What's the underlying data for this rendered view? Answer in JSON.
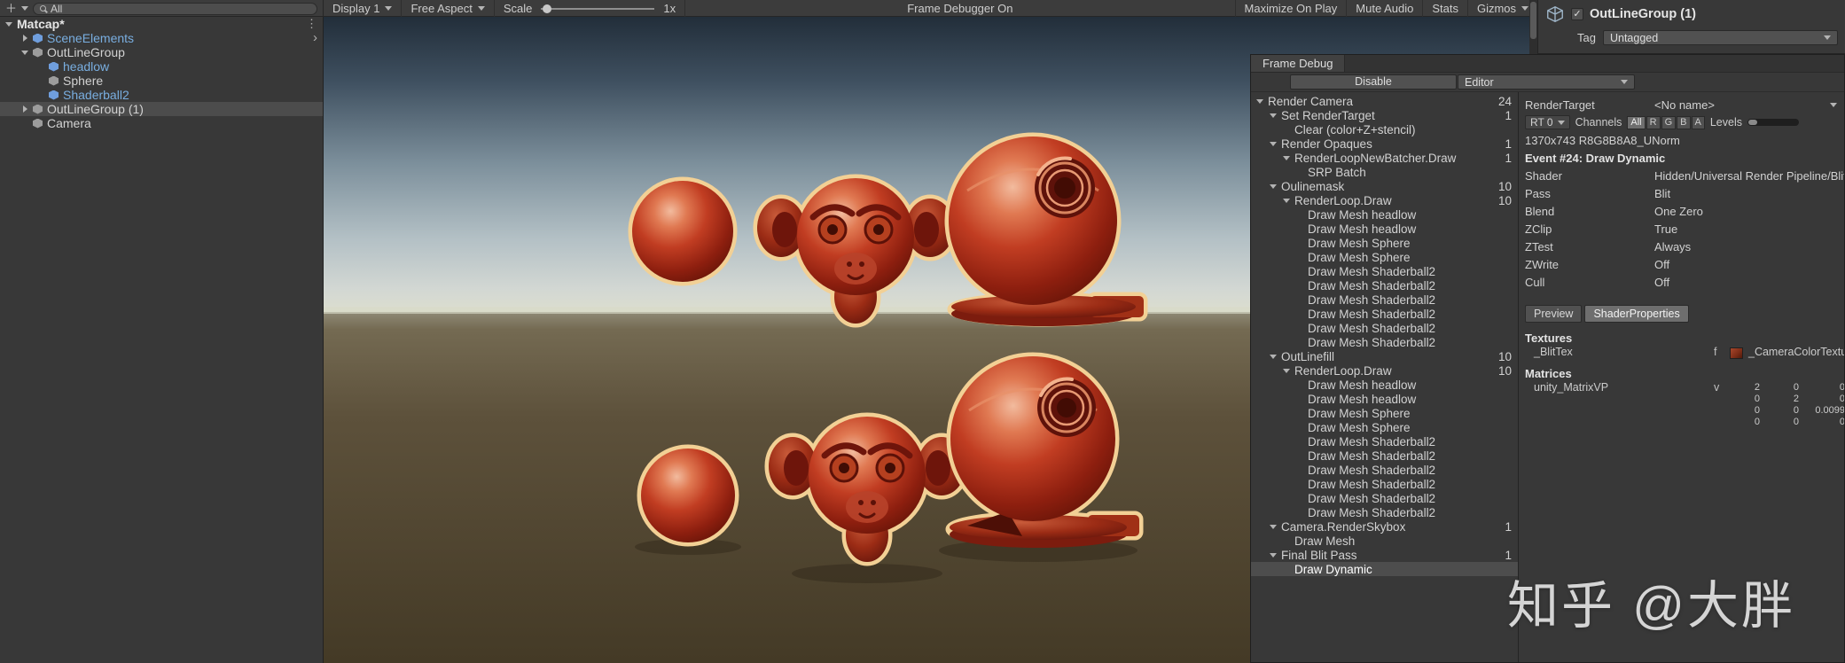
{
  "toolbar": {
    "search_value": "All",
    "display": "Display 1",
    "aspect": "Free Aspect",
    "scale_label": "Scale",
    "scale_value": "1x",
    "frame_debugger_toggle": "Frame Debugger On",
    "maximize_on_play": "Maximize On Play",
    "mute_audio": "Mute Audio",
    "stats": "Stats",
    "gizmos": "Gizmos"
  },
  "hierarchy": {
    "items": [
      {
        "label": "Matcap*",
        "depth": 0,
        "arrow": "down",
        "bold": true,
        "kebab": true
      },
      {
        "label": "SceneElements",
        "depth": 1,
        "arrow": "right",
        "icon": "prefab-cube",
        "prefab": true,
        "chevron": true
      },
      {
        "label": "OutLineGroup",
        "depth": 1,
        "arrow": "down",
        "icon": "cube"
      },
      {
        "label": "headlow",
        "depth": 2,
        "icon": "prefab-cube",
        "prefab": true
      },
      {
        "label": "Sphere",
        "depth": 2,
        "icon": "cube"
      },
      {
        "label": "Shaderball2",
        "depth": 2,
        "icon": "prefab-cube",
        "prefab": true
      },
      {
        "label": "OutLineGroup (1)",
        "depth": 1,
        "arrow": "right",
        "icon": "cube",
        "selected": true
      },
      {
        "label": "Camera",
        "depth": 1,
        "icon": "camera"
      }
    ]
  },
  "frame_debug": {
    "tab_title": "Frame Debug",
    "disable_button": "Disable",
    "editor_dropdown": "Editor",
    "tree": [
      {
        "label": "Render Camera",
        "count": "24",
        "depth": 0,
        "arrow": true
      },
      {
        "label": "Set RenderTarget",
        "count": "1",
        "depth": 1,
        "arrow": true
      },
      {
        "label": "Clear (color+Z+stencil)",
        "depth": 2
      },
      {
        "label": "Render Opaques",
        "count": "1",
        "depth": 1,
        "arrow": true
      },
      {
        "label": "RenderLoopNewBatcher.Draw",
        "count": "1",
        "depth": 2,
        "arrow": true
      },
      {
        "label": "SRP Batch",
        "depth": 3
      },
      {
        "label": "Oulinemask",
        "count": "10",
        "depth": 1,
        "arrow": true
      },
      {
        "label": "RenderLoop.Draw",
        "count": "10",
        "depth": 2,
        "arrow": true
      },
      {
        "label": "Draw Mesh headlow",
        "depth": 3
      },
      {
        "label": "Draw Mesh headlow",
        "depth": 3
      },
      {
        "label": "Draw Mesh Sphere",
        "depth": 3
      },
      {
        "label": "Draw Mesh Sphere",
        "depth": 3
      },
      {
        "label": "Draw Mesh Shaderball2",
        "depth": 3
      },
      {
        "label": "Draw Mesh Shaderball2",
        "depth": 3
      },
      {
        "label": "Draw Mesh Shaderball2",
        "depth": 3
      },
      {
        "label": "Draw Mesh Shaderball2",
        "depth": 3
      },
      {
        "label": "Draw Mesh Shaderball2",
        "depth": 3
      },
      {
        "label": "Draw Mesh Shaderball2",
        "depth": 3
      },
      {
        "label": "OutLinefill",
        "count": "10",
        "depth": 1,
        "arrow": true
      },
      {
        "label": "RenderLoop.Draw",
        "count": "10",
        "depth": 2,
        "arrow": true
      },
      {
        "label": "Draw Mesh headlow",
        "depth": 3
      },
      {
        "label": "Draw Mesh headlow",
        "depth": 3
      },
      {
        "label": "Draw Mesh Sphere",
        "depth": 3
      },
      {
        "label": "Draw Mesh Sphere",
        "depth": 3
      },
      {
        "label": "Draw Mesh Shaderball2",
        "depth": 3
      },
      {
        "label": "Draw Mesh Shaderball2",
        "depth": 3
      },
      {
        "label": "Draw Mesh Shaderball2",
        "depth": 3
      },
      {
        "label": "Draw Mesh Shaderball2",
        "depth": 3
      },
      {
        "label": "Draw Mesh Shaderball2",
        "depth": 3
      },
      {
        "label": "Draw Mesh Shaderball2",
        "depth": 3
      },
      {
        "label": "Camera.RenderSkybox",
        "count": "1",
        "depth": 1,
        "arrow": true
      },
      {
        "label": "Draw Mesh",
        "depth": 2
      },
      {
        "label": "Final Blit Pass",
        "count": "1",
        "depth": 1,
        "arrow": true
      },
      {
        "label": "Draw Dynamic",
        "depth": 2,
        "selected": true
      }
    ]
  },
  "details": {
    "render_target_label": "RenderTarget",
    "render_target_value": "<No name>",
    "rt_dropdown": "RT 0",
    "channels_label": "Channels",
    "channels": [
      "All",
      "R",
      "G",
      "B",
      "A"
    ],
    "channels_active": "All",
    "levels_label": "Levels",
    "buffer_info": "1370x743 R8G8B8A8_UNorm",
    "event_title": "Event #24: Draw Dynamic",
    "properties": [
      {
        "key": "Shader",
        "value": "Hidden/Universal Render Pipeline/Blit,"
      },
      {
        "key": "Pass",
        "value": "Blit"
      },
      {
        "key": "Blend",
        "value": "One Zero"
      },
      {
        "key": "ZClip",
        "value": "True"
      },
      {
        "key": "ZTest",
        "value": "Always"
      },
      {
        "key": "ZWrite",
        "value": "Off"
      },
      {
        "key": "Cull",
        "value": "Off"
      }
    ],
    "tabs": [
      "Preview",
      "ShaderProperties"
    ],
    "active_tab": "ShaderProperties",
    "textures_header": "Textures",
    "textures": [
      {
        "name": "_BlitTex",
        "type": "f",
        "value": "_CameraColorTextu"
      }
    ],
    "matrices_header": "Matrices",
    "matrices": [
      {
        "name": "unity_MatrixVP",
        "type": "v",
        "rows": [
          [
            "2",
            "0",
            "0"
          ],
          [
            "0",
            "2",
            "0"
          ],
          [
            "0",
            "0",
            "0.0099"
          ],
          [
            "0",
            "0",
            "0"
          ]
        ]
      }
    ]
  },
  "inspector": {
    "title": "OutLineGroup (1)",
    "checkbox_checked": "✓",
    "tag_label": "Tag",
    "tag_value": "Untagged"
  },
  "watermark": "知乎 @大胖",
  "colors": {
    "outline_yellow": "#f2d095",
    "matcap_red": "#c13d22",
    "selection_gray": "#4c4c4c",
    "prefab_blue": "#79aee0"
  }
}
